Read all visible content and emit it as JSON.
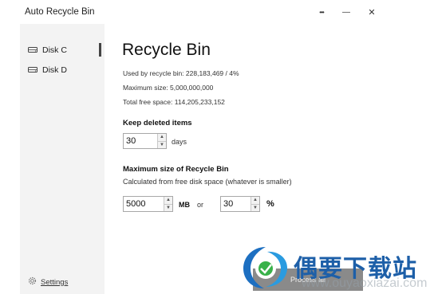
{
  "window": {
    "title": "Auto Recycle Bin",
    "more_label": "•••",
    "min_label": "—",
    "close_label": "✕"
  },
  "sidebar": {
    "items": [
      {
        "label": "Disk C",
        "icon": "drive-icon",
        "selected": true
      },
      {
        "label": "Disk D",
        "icon": "drive-icon",
        "selected": false
      }
    ],
    "settings_label": "Settings",
    "settings_icon": "gear-icon"
  },
  "main": {
    "title": "Recycle Bin",
    "used_line": "Used by recycle bin: 228,183,469 / 4%",
    "max_line": "Maximum size: 5,000,000,000",
    "free_line": "Total free space: 114,205,233,152",
    "keep": {
      "heading": "Keep deleted items",
      "value": "30",
      "unit": "days"
    },
    "max_size": {
      "heading": "Maximum size of Recycle Bin",
      "description": "Calculated from free disk space (whatever is smaller)",
      "mb_value": "5000",
      "mb_unit": "MB",
      "or_label": "or",
      "pct_value": "30",
      "pct_unit": "%"
    },
    "process_button": "Process all"
  },
  "watermark": {
    "text": "偶要下载站",
    "url": "www.ouyaoxiazai.com"
  },
  "colors": {
    "sidebar_bg": "#f3f3f3",
    "button_bg": "#8a8a8a",
    "watermark_blue": "#1d5fa8"
  }
}
